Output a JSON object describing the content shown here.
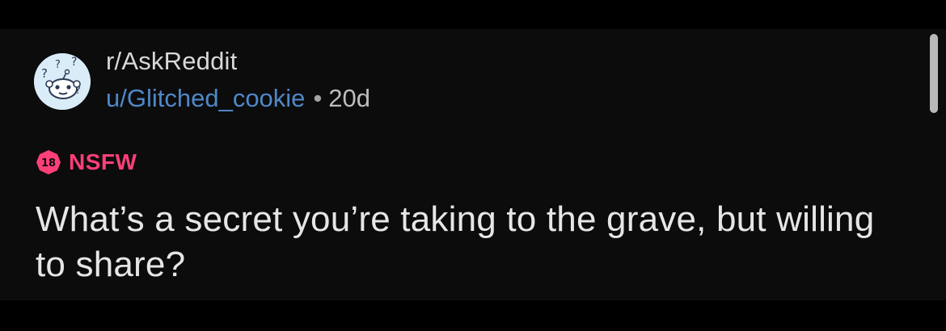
{
  "post": {
    "subreddit": "r/AskReddit",
    "author": "u/Glitched_cookie",
    "separator": "•",
    "age": "20d",
    "nsfw_badge": "18",
    "nsfw_label": "NSFW",
    "title": "What’s a secret you’re taking to the grave, but willing to share?"
  },
  "icons": {
    "avatar": "subreddit-avatar-icon",
    "nsfw": "nsfw-18-icon"
  },
  "colors": {
    "background": "#0c0c0d",
    "text_primary": "#e6e6e6",
    "username": "#4f88c7",
    "nsfw": "#ff3f78"
  }
}
